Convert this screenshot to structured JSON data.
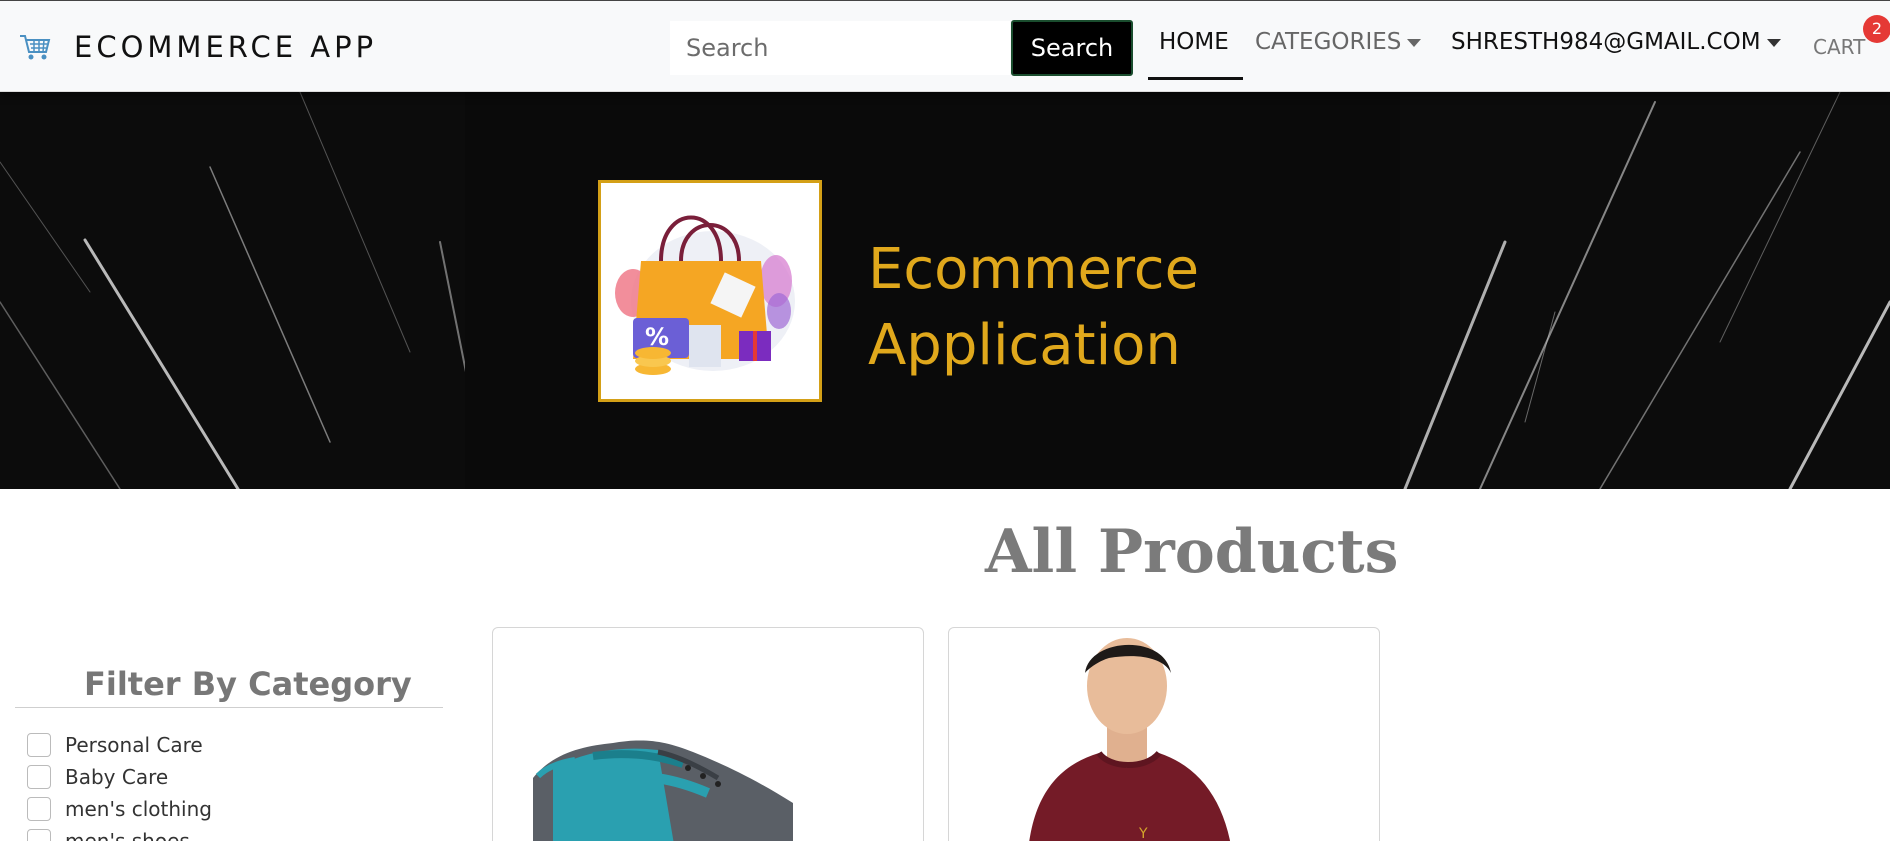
{
  "navbar": {
    "brand_icon": "cart-icon",
    "brand": "ECOMMERCE APP",
    "search_placeholder": "Search",
    "search_button": "Search",
    "home": "HOME",
    "categories": "CATEGORIES",
    "user": "SHRESTH984@GMAIL.COM",
    "cart": "CART",
    "cart_count": "2"
  },
  "hero": {
    "title_line1": "Ecommerce",
    "title_line2": "Application",
    "logo_icon": "shopping-bag-icon"
  },
  "main": {
    "heading": "All Products"
  },
  "filter": {
    "title": "Filter By Category",
    "items": [
      {
        "label": "Personal Care",
        "checked": false
      },
      {
        "label": "Baby Care",
        "checked": false
      },
      {
        "label": "men's clothing",
        "checked": false
      },
      {
        "label": "men's shoes",
        "checked": false
      }
    ]
  },
  "products": [
    {
      "image": "sports-shoe-image"
    },
    {
      "image": "maroon-sweatshirt-image"
    }
  ],
  "colors": {
    "accent_gold": "#e0a81c",
    "badge_red": "#e53935",
    "heading_grey": "#7b7b7b"
  }
}
